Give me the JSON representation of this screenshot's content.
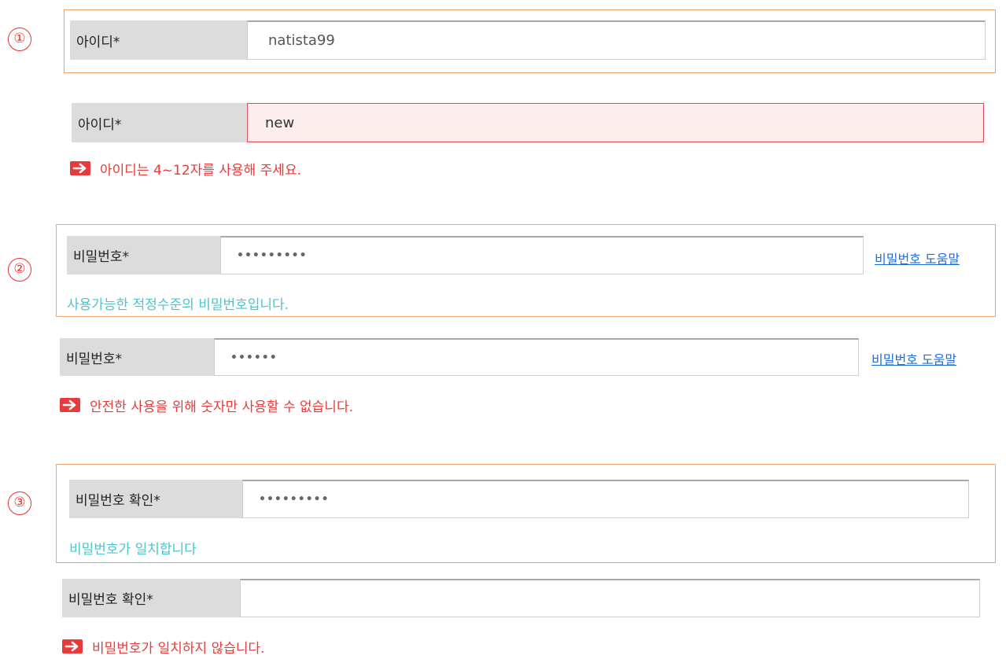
{
  "markers": [
    "①",
    "②",
    "③"
  ],
  "id_section": {
    "valid": {
      "label": "아이디*",
      "value": "natista99"
    },
    "invalid": {
      "label": "아이디*",
      "value": "new",
      "error": "아이디는 4~12자를 사용해 주세요."
    }
  },
  "password_section": {
    "valid": {
      "label": "비밀번호*",
      "value": "•••••••••",
      "help_link": "비밀번호 도움말",
      "message": "사용가능한 적정수준의 비밀번호입니다."
    },
    "invalid": {
      "label": "비밀번호*",
      "value": "••••••",
      "help_link": "비밀번호 도움말",
      "error": "안전한 사용을 위해 숫자만 사용할 수 없습니다."
    }
  },
  "confirm_section": {
    "valid": {
      "label": "비밀번호 확인*",
      "value": "•••••••••",
      "message": "비밀번호가 일치합니다"
    },
    "invalid": {
      "label": "비밀번호 확인*",
      "value": "",
      "error": "비밀번호가 일치하지 않습니다."
    }
  },
  "colors": {
    "error": "#e83a3a",
    "success": "#4cc4cf",
    "link": "#1f6fd6",
    "group_border": "#f2a36b",
    "label_bg": "#dcdcdc"
  },
  "icons": {
    "error_marker": "arrow-right-icon"
  }
}
